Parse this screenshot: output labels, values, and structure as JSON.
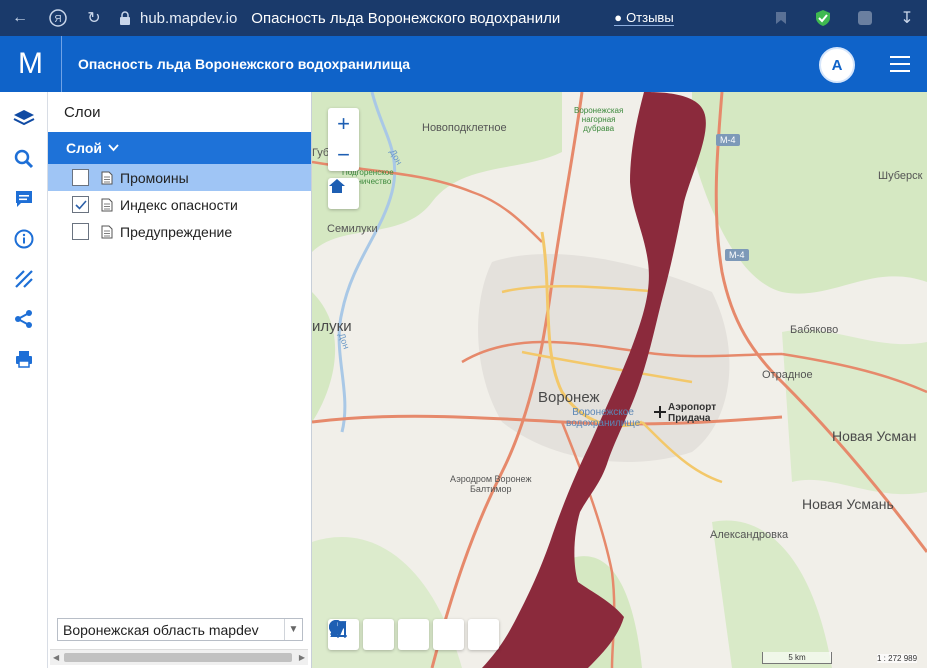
{
  "browser": {
    "host": "hub.mapdev.io",
    "tab_title": "Опасность льда Воронежского водохранили",
    "feedback_label": "Отзывы"
  },
  "app": {
    "logo": "M",
    "title": "Опасность льда Воронежского водохранилища",
    "user_initial": "A"
  },
  "panel": {
    "title": "Слои",
    "group_label": "Слой",
    "layers": [
      {
        "label": "Промоины",
        "checked": false
      },
      {
        "label": "Индекс опасности",
        "checked": true
      },
      {
        "label": "Предупреждение",
        "checked": false
      }
    ],
    "region_select": "Воронежская область mapdev"
  },
  "map": {
    "labels": {
      "novopodklyatnoe": "Новоподклетное",
      "gubaryovo": "Губ",
      "semiluki": "Семилуки",
      "semiluki_left": "илуки",
      "voronezh": "Воронеж",
      "airport": "Аэропорт\nПридача",
      "shubersk": "Шуберск",
      "babyakovo": "Бабяково",
      "otradnoe": "Отрадное",
      "novaya_usman_1": "Новая Усман",
      "novaya_usman_2": "Новая Усмань",
      "aleksandrovka": "Александровка",
      "airfield": "Аэродром Воронеж\nБалтимор",
      "forest_north": "Воронежская\nнагорная\nдубрава",
      "forest_west": "Подгоренское\nлесничество",
      "reservoir": "Воронежское\nводохранилище",
      "river_don": "Дон",
      "river_don2": "Дон",
      "m4_top": "М-4",
      "m4_mid": "М-4"
    },
    "scale_label": "5 km",
    "scale_ratio": "1 : 272 989",
    "colors": {
      "reservoir_fill": "#8b2a3c",
      "road_major": "#e6896b",
      "road_arterial": "#f3c86a",
      "green": "#cfe6b8",
      "brand": "#0f63c9"
    }
  }
}
